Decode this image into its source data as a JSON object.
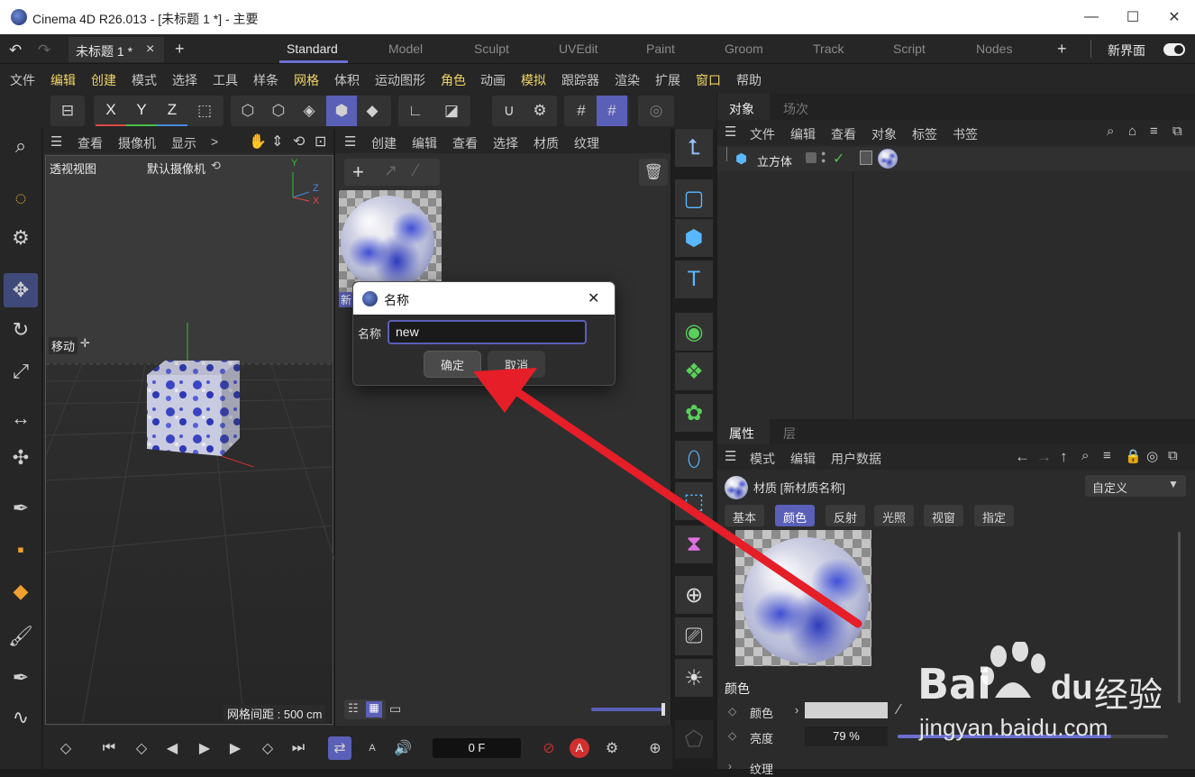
{
  "window": {
    "title": "Cinema 4D R26.013 - [未标题 1 *] - 主要",
    "minimize": "—",
    "maximize": "☐",
    "close": "✕"
  },
  "layoutbar": {
    "doc_tab": "未标题 1 *",
    "doc_tab_close": "×",
    "new_tab": "+",
    "layouts": [
      "Standard",
      "Model",
      "Sculpt",
      "UVEdit",
      "Paint",
      "Groom",
      "Track",
      "Script",
      "Nodes"
    ],
    "active_layout": "Standard",
    "add_layout": "+",
    "new_ui_label": "新界面"
  },
  "menubar": {
    "items": [
      "文件",
      "编辑",
      "创建",
      "模式",
      "选择",
      "工具",
      "样条",
      "网格",
      "体积",
      "运动图形",
      "角色",
      "动画",
      "模拟",
      "跟踪器",
      "渲染",
      "扩展",
      "窗口",
      "帮助"
    ],
    "highlighted": [
      "编辑",
      "创建",
      "网格",
      "角色",
      "模拟",
      "窗口"
    ]
  },
  "toolbar": {
    "axis_x": "X",
    "axis_y": "Y",
    "axis_z": "Z",
    "colors": {
      "x": "#e04848",
      "y": "#48c048",
      "z": "#4888e0"
    }
  },
  "viewport": {
    "menu": [
      "查看",
      "摄像机",
      "显示"
    ],
    "more": ">",
    "view_name": "透视视图",
    "camera_name": "默认摄像机",
    "move_label": "移动",
    "grid_spacing": "网格间距 : 500 cm",
    "axis_labels": {
      "y": "Y",
      "z": "Z",
      "x": "X"
    }
  },
  "material_manager": {
    "menu": [
      "创建",
      "编辑",
      "查看",
      "选择",
      "材质",
      "纹理"
    ],
    "material_label": "新"
  },
  "dialog": {
    "title": "名称",
    "field_label": "名称",
    "field_value": "new",
    "ok_label": "确定",
    "cancel_label": "取消",
    "close": "✕"
  },
  "object_manager": {
    "tabs": [
      "对象",
      "场次"
    ],
    "menu": [
      "文件",
      "编辑",
      "查看",
      "对象",
      "标签",
      "书签"
    ],
    "object_name": "立方体"
  },
  "attribute_manager": {
    "tabs": [
      "属性",
      "层"
    ],
    "menu": [
      "模式",
      "编辑",
      "用户数据"
    ],
    "material_title": "材质 [新材质名称]",
    "preset": "自定义",
    "subtabs": [
      "基本",
      "颜色",
      "反射",
      "光照",
      "视窗",
      "指定"
    ],
    "active_subtab": "颜色",
    "section_title": "颜色",
    "color_label": "颜色",
    "brightness_label": "亮度",
    "brightness_value": "79 %",
    "brightness_fraction": 0.79,
    "texture_label": "纹理"
  },
  "timeline": {
    "frame": "0 F",
    "record_label": "A"
  },
  "watermark": {
    "brand": "Bai",
    "brand_du": "du",
    "brand_cn": "经验",
    "url": "jingyan.baidu.com"
  }
}
